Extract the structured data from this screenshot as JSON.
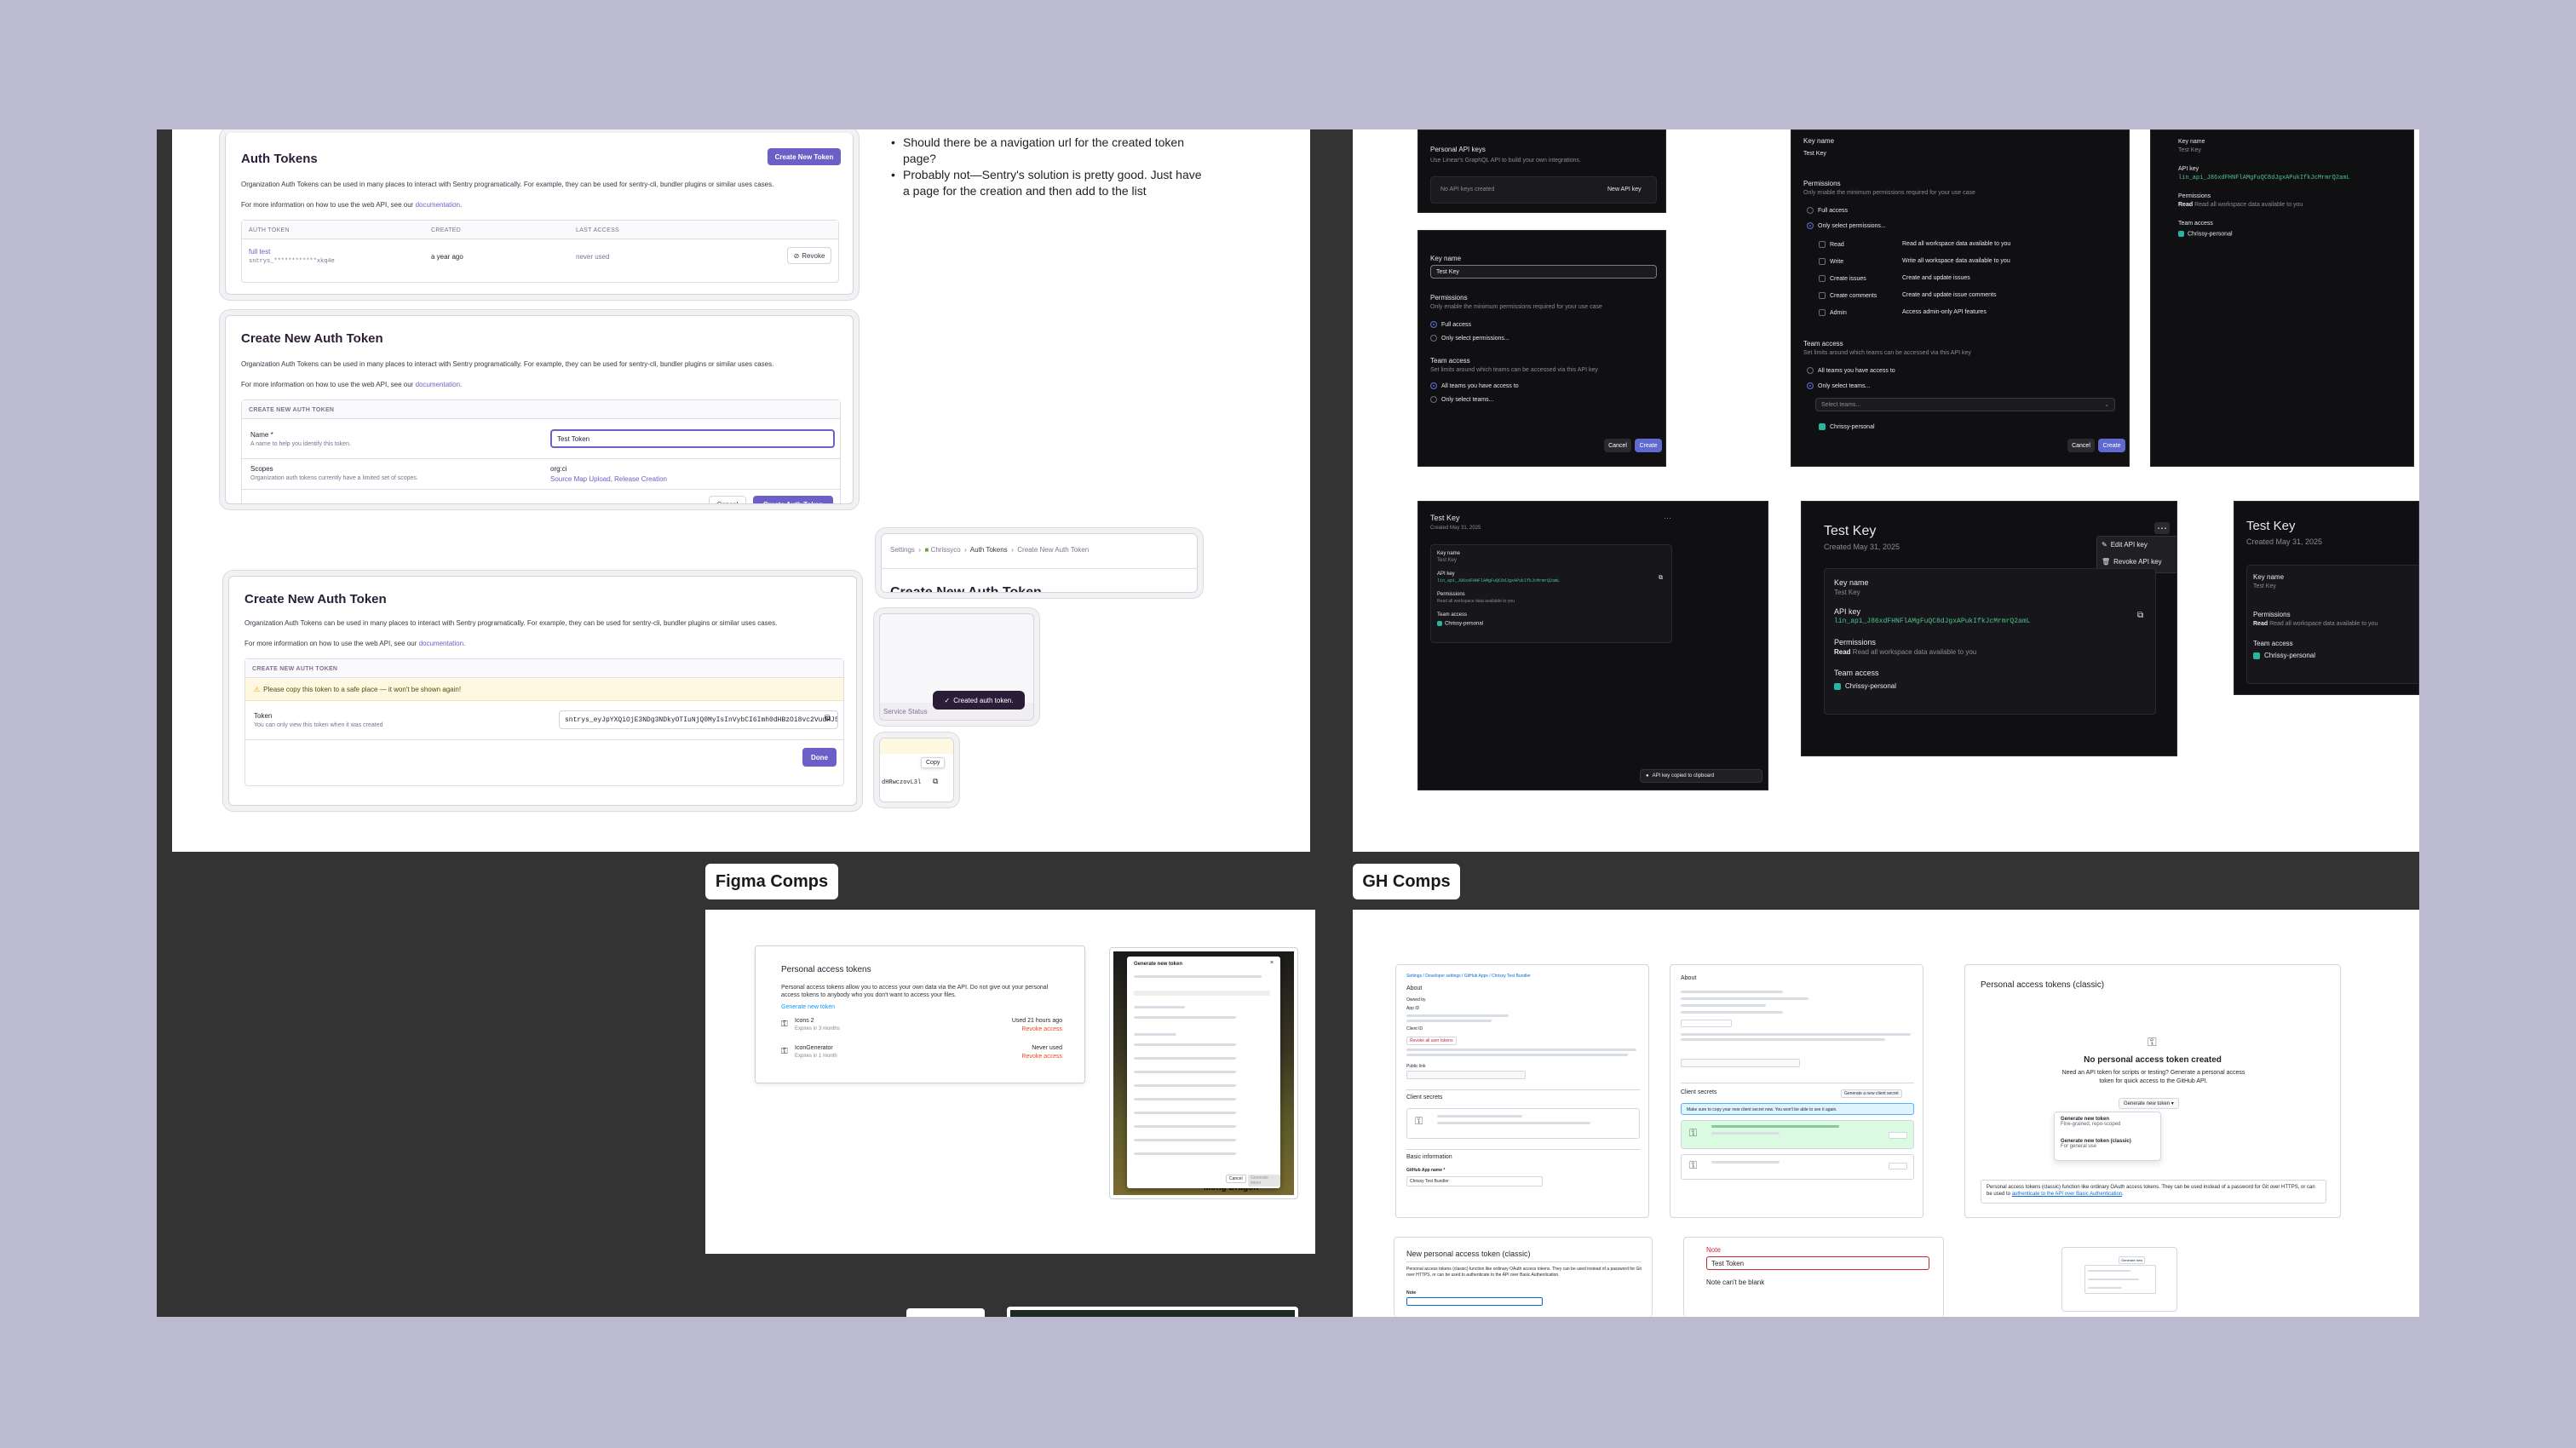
{
  "auth_tokens_card": {
    "title": "Auth Tokens",
    "create_button": "Create New Token",
    "desc1": "Organization Auth Tokens can be used in many places to interact with Sentry programatically. For example, they can be used for sentry-cli, bundler plugins or similar uses cases.",
    "desc2": "For more information on how to use the web API, see our ",
    "desc2_link": "documentation",
    "col_token": "AUTH TOKEN",
    "col_created": "CREATED",
    "col_last": "LAST ACCESS",
    "row_name": "full test",
    "row_token": "sntrys_************xkq4e",
    "row_created": "a year ago",
    "row_last": "never used",
    "revoke": "Revoke"
  },
  "create_form": {
    "title": "Create New Auth Token",
    "desc1": "Organization Auth Tokens can be used in many places to interact with Sentry programatically. For example, they can be used for sentry-cli, bundler plugins or similar uses cases.",
    "desc2": "For more information on how to use the web API, see our ",
    "desc2_link": "documentation",
    "panel_header": "CREATE NEW AUTH TOKEN",
    "name_label": "Name *",
    "name_help": "A name to help you identify this token.",
    "name_value": "Test Token",
    "scopes_label": "Scopes",
    "scopes_help": "Organization auth tokens currently have a limited set of scopes.",
    "scopes_value": "org:ci",
    "scopes_detail": "Source Map Upload, Release Creation",
    "cancel": "Cancel",
    "submit": "Create Auth Token"
  },
  "created_form": {
    "title": "Create New Auth Token",
    "desc1": "Organization Auth Tokens can be used in many places to interact with Sentry programatically. For example, they can be used for sentry-cli, bundler plugins or similar uses cases.",
    "desc2": "For more information on how to use the web API, see our ",
    "desc2_link": "documentation",
    "panel_header": "CREATE NEW AUTH TOKEN",
    "warning": "Please copy this token to a safe place — it won't be shown again!",
    "token_label": "Token",
    "token_help": "You can only view this token when it was created",
    "token_value": "sntrys_eyJpYXQiOjE3NDg3NDkyOTIuNjQ0MyIsInVybCI6Imh0dHBzOi8vc2VudHJ5LmlvIiwicmVnaW9uX3VybCI6Imh0dHBzOi8vdXMuc2VudHJ5LmlvIiwib3JnIjoiY2hyaXNzeSJ9_dHRwczovL3",
    "done": "Done"
  },
  "notes": {
    "bullet1": "Should there be a navigation url for the created token page?",
    "bullet2": "Probably not—Sentry's solution is pretty good. Just have a page for the creation and then add to the list"
  },
  "breadcrumb": {
    "items": [
      "Settings",
      "Chrissyco",
      "Auth Tokens",
      "Create New Auth Token"
    ],
    "partial_title": "Create New Auth Token"
  },
  "toast_snip": {
    "footer": "Service Status",
    "toast": "Created auth token."
  },
  "copy_snip": {
    "tooltip": "Copy",
    "value": "dHRwczovL3l"
  },
  "linear_list": {
    "title": "Personal API keys",
    "desc": "Use Linear's GraphQL API to build your own integrations.",
    "empty": "No API keys created",
    "new_button": "New API key"
  },
  "linear_create": {
    "key_name_label": "Key name",
    "key_name_value": "Test Key",
    "permissions_title": "Permissions",
    "permissions_desc": "Only enable the minimum permissions required for your use case",
    "full_access": "Full access",
    "only_select": "Only select permissions...",
    "team_title": "Team access",
    "team_desc": "Set limits around which teams can be accessed via this API key",
    "all_teams": "All teams you have access to",
    "only_teams": "Only select teams...",
    "cancel": "Cancel",
    "create": "Create"
  },
  "linear_perms": {
    "key_name_label": "Key name",
    "key_name_value": "Test Key",
    "permissions_title": "Permissions",
    "permissions_desc": "Only enable the minimum permissions required for your use case",
    "full_access": "Full access",
    "only_select": "Only select permissions...",
    "rows": [
      {
        "name": "Read",
        "desc": "Read all workspace data available to you"
      },
      {
        "name": "Write",
        "desc": "Write all workspace data available to you"
      },
      {
        "name": "Create issues",
        "desc": "Create and update issues"
      },
      {
        "name": "Create comments",
        "desc": "Create and update issue comments"
      },
      {
        "name": "Admin",
        "desc": "Access admin-only API features"
      }
    ],
    "team_title": "Team access",
    "team_desc": "Set limits around which teams can be accessed via this API key",
    "all_teams": "All teams you have access to",
    "only_teams": "Only select teams...",
    "select_placeholder": "Select teams...",
    "team_chip": "Chrissy-personal",
    "cancel": "Cancel",
    "create": "Create"
  },
  "linear_result_top": {
    "key_name_label": "Key name",
    "key_name_value": "Test Key",
    "api_key_label": "API key",
    "api_key_value": "lin_api_J86xdFHNFlAMgFuQC8dJgxAPukIfkJcMrmrQ2amL",
    "permissions_label": "Permissions",
    "permissions_value_strong": "Read",
    "permissions_value": "Read all workspace data available to you",
    "team_label": "Team access",
    "team_value": "Chrissy-personal"
  },
  "linear_detail_small": {
    "title": "Test Key",
    "created": "Created May 31, 2025",
    "key_name_label": "Key name",
    "key_name_value": "Test Key",
    "api_key_label": "API key",
    "api_key_value": "lin_api_J86xdFHNFlAMgFuQC8dJgxAPukIfkJcMrmrQ2amL",
    "permissions_label": "Permissions",
    "permissions_value": "Read all workspace data available to you",
    "team_label": "Team access",
    "team_value": "Chrissy-personal",
    "toast": "API key copied to clipboard"
  },
  "linear_detail_big": {
    "title": "Test Key",
    "created": "Created May 31, 2025",
    "key_name_label": "Key name",
    "key_name_value": "Test Key",
    "api_key_label": "API key",
    "api_key_value": "lin_api_J86xdFHNFlAMgFuQC8dJgxAPukIfkJcMrmrQ2amL",
    "permissions_label": "Permissions",
    "permissions_value_strong": "Read",
    "permissions_value": "Read all workspace data available to you",
    "team_label": "Team access",
    "team_value": "Chrissy-personal",
    "menu_edit": "Edit API key",
    "menu_revoke": "Revoke API key"
  },
  "linear_detail_right": {
    "title": "Test Key",
    "created": "Created May 31, 2025",
    "key_name_label": "Key name",
    "key_name_value": "Test Key",
    "permissions_label": "Permissions",
    "permissions_value_strong": "Read",
    "permissions_value": "Read all workspace data available to you",
    "team_label": "Team access",
    "team_value": "Chrissy-personal"
  },
  "labels": {
    "figma": "Figma Comps",
    "gh": "GH Comps"
  },
  "figma_pat": {
    "title": "Personal access tokens",
    "desc": "Personal access tokens allow you to access your own data via the API. Do not give out your personal access tokens to anybody who you don't want to access your files.",
    "generate": "Generate new token",
    "tokens": [
      {
        "name": "Icons 2",
        "expires": "Expires in 3 months",
        "used": "Used 21 hours ago",
        "action": "Revoke access"
      },
      {
        "name": "IconGenerator",
        "expires": "Expires in 1 month",
        "used": "Never used",
        "action": "Revoke access"
      }
    ]
  },
  "figma_modal": {
    "title": "Generate new token",
    "cancel": "Cancel",
    "generate": "Generate token",
    "bg_text": "Mong Dragon"
  },
  "gh_app": {
    "breadcrumb": "Settings / Developer settings / GitHub Apps / Chrissy Test Bundler",
    "about": "About",
    "owned_by": "Owned by",
    "app_id": "App ID",
    "client_id": "Client ID",
    "revoke_all": "Revoke all user tokens",
    "public_link": "Public link",
    "client_secrets": "Client secrets",
    "basic_info": "Basic information",
    "app_name_label": "GitHub App name *",
    "app_name_value": "Chrissy Test Bundler"
  },
  "gh_app2": {
    "about": "About",
    "client_secrets": "Client secrets",
    "generate_secret": "Generate a new client secret",
    "notice": "Make sure to copy your new client secret now. You won't be able to see it again."
  },
  "gh_classic": {
    "title": "Personal access tokens (classic)",
    "empty_title": "No personal access token created",
    "empty_desc": "Need an API token for scripts or testing? Generate a personal access token for quick access to the GitHub API.",
    "generate": "Generate new token",
    "opt1_title": "Generate new token",
    "opt1_desc": "Fine-grained, repo-scoped",
    "opt2_title": "Generate new token (classic)",
    "opt2_desc": "For general use",
    "footer": "Personal access tokens (classic) function like ordinary OAuth access tokens. They can be used instead of a password for Git over HTTPS, or can be used to ",
    "footer_link": "authenticate to the API over Basic Authentication"
  },
  "gh_new_classic": {
    "title": "New personal access token (classic)",
    "desc": "Personal access tokens (classic) function like ordinary OAuth access tokens. They can be used instead of a password for Git over HTTPS, or can be used to authenticate to the API over Basic Authentication.",
    "note_label": "Note"
  },
  "gh_note_error": {
    "note_label": "Note",
    "value": "Test Token",
    "error": "Note can't be blank"
  },
  "gh_tiny": {
    "label": "Generate new"
  },
  "colors": {
    "background": "#bcbad1",
    "board": "#333333",
    "sentry_purple": "#6c5fc7",
    "linear_blue": "#5e6ad2",
    "gh_green": "#1f883d",
    "danger": "#cf222e"
  }
}
